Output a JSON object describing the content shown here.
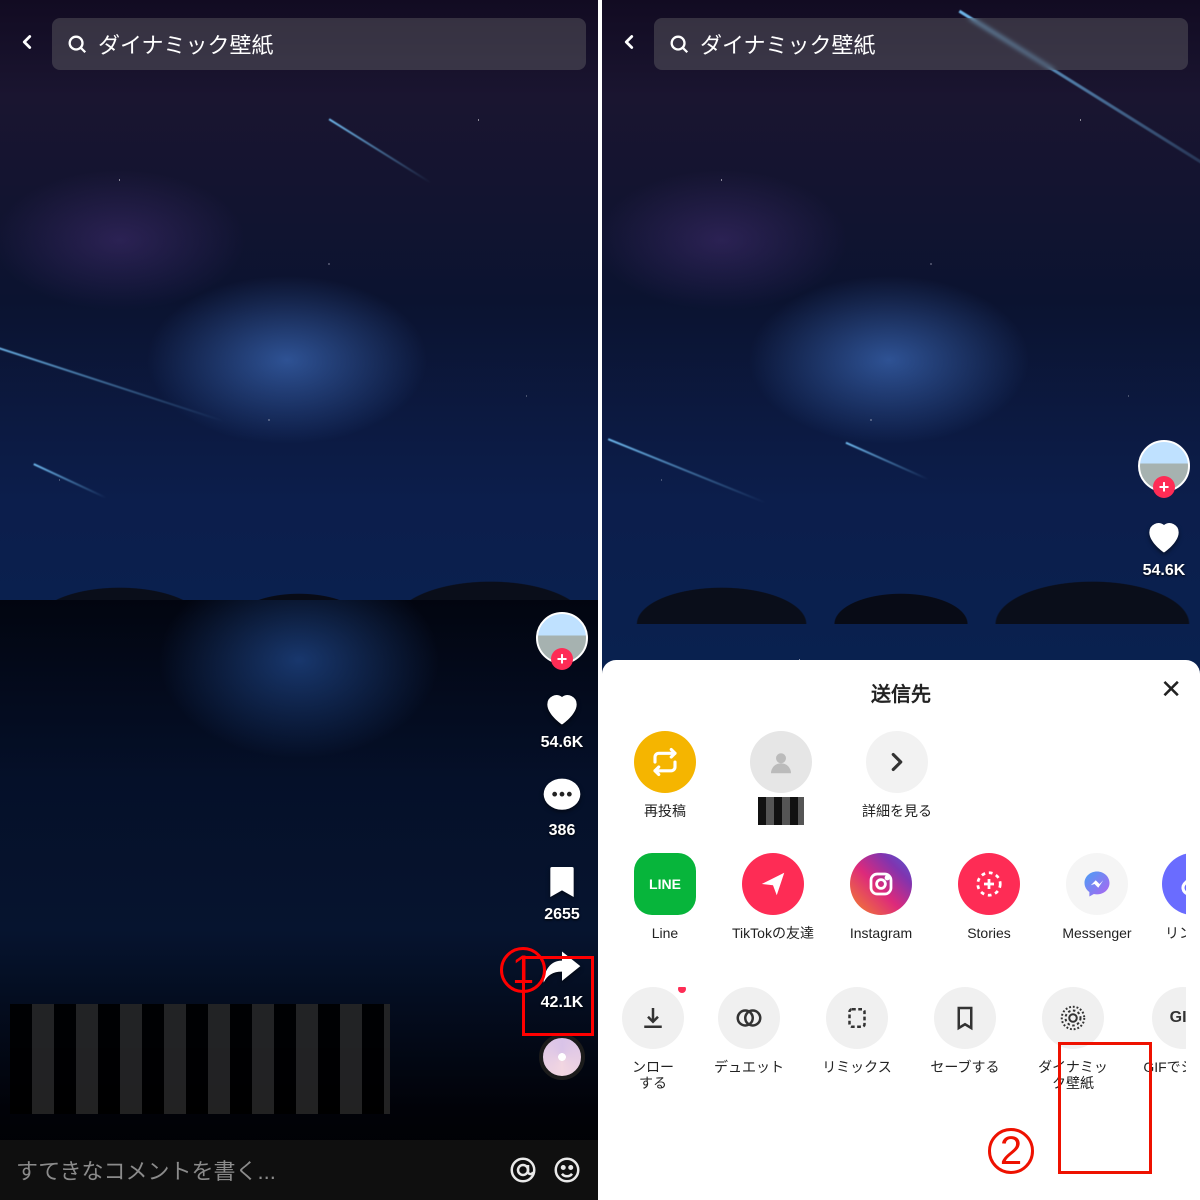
{
  "callouts": {
    "one": "1",
    "two": "2"
  },
  "search": {
    "text": "ダイナミック壁紙"
  },
  "stats": {
    "likes": "54.6K",
    "comments": "386",
    "saves": "2655",
    "shares": "42.1K"
  },
  "comment_placeholder": "すてきなコメントを書く...",
  "share": {
    "title": "送信先",
    "contacts": [
      {
        "label": "再投稿"
      },
      {
        "label": ""
      },
      {
        "label": "詳細を見る"
      }
    ],
    "apps": [
      {
        "label": "Line"
      },
      {
        "label": "TikTokの友達"
      },
      {
        "label": "Instagram"
      },
      {
        "label": "Stories"
      },
      {
        "label": "Messenger"
      },
      {
        "label": "リンクコピ"
      }
    ],
    "actions": [
      {
        "label": "ンロー\nする"
      },
      {
        "label": "デュエット"
      },
      {
        "label": "リミックス"
      },
      {
        "label": "セーブする"
      },
      {
        "label": "ダイナミッ\nク壁紙"
      },
      {
        "label": "GIFでシェア",
        "text": "GIF"
      }
    ]
  }
}
